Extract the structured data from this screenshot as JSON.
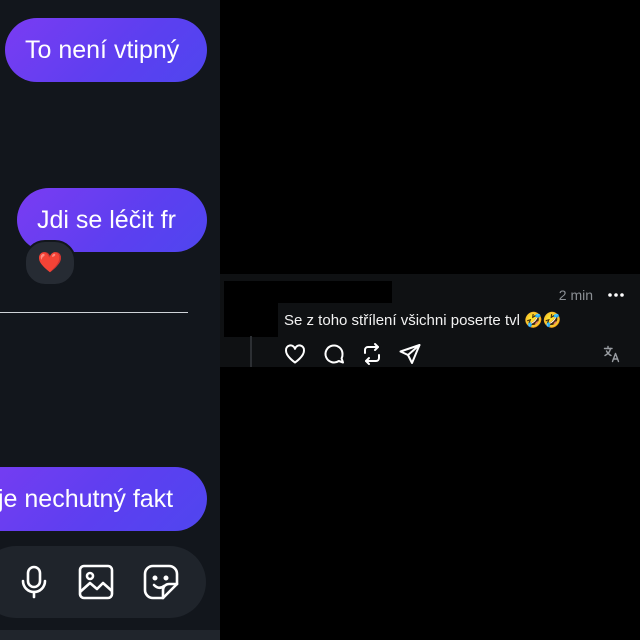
{
  "chat": {
    "messages": [
      {
        "text": "To není vtipný"
      },
      {
        "text": "Jdi se léčit fr",
        "reaction": "❤️"
      },
      {
        "text": "je nechutný fakt"
      }
    ],
    "composer": {
      "icons": [
        "microphone-icon",
        "image-icon",
        "sticker-icon"
      ]
    }
  },
  "comment": {
    "timestamp": "2 min",
    "text": "Se z toho střílení všichni poserte tvl 🤣🤣",
    "actions": [
      "heart-icon",
      "reply-icon",
      "repost-icon",
      "share-icon"
    ],
    "translate_icon": "translate-icon",
    "more_icon": "more-icon"
  },
  "colors": {
    "bubble_start": "#7a3cf2",
    "bubble_end": "#4f46ef",
    "chat_background": "#12161c",
    "page_background": "#000000",
    "card_background": "#0f1113"
  }
}
